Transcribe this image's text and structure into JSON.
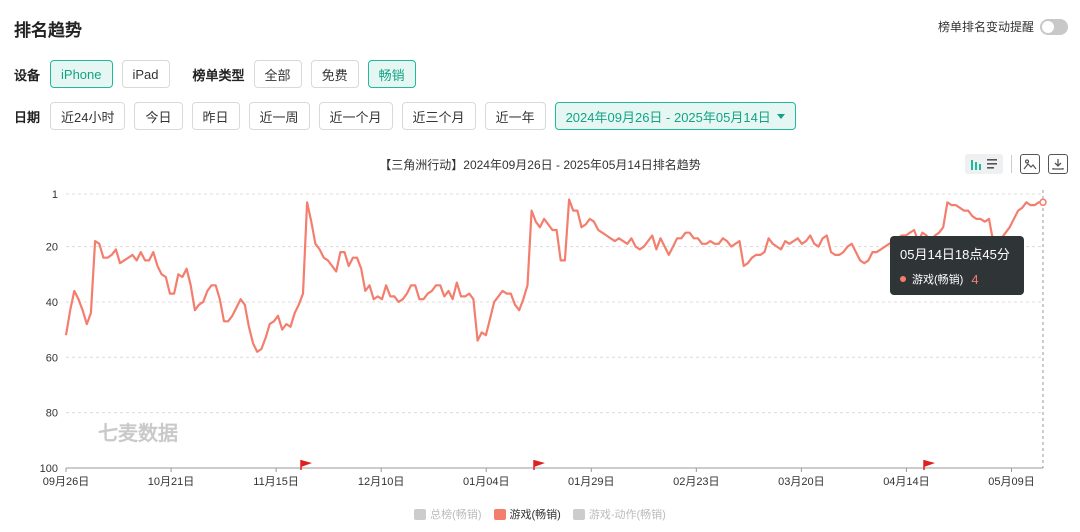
{
  "header": {
    "title": "排名趋势",
    "alert_label": "榜单排名变动提醒"
  },
  "filters": {
    "device_label": "设备",
    "devices": [
      "iPhone",
      "iPad"
    ],
    "list_type_label": "榜单类型",
    "list_types": [
      "全部",
      "免费",
      "畅销"
    ],
    "date_label": "日期",
    "dates": [
      "近24小时",
      "今日",
      "昨日",
      "近一周",
      "近一个月",
      "近三个月",
      "近一年"
    ],
    "date_range": "2024年09月26日 - 2025年05月14日"
  },
  "colors": {
    "accent": "#1fb99e",
    "series": "#f47e6e"
  },
  "icons": {
    "bar": "bar-chart-icon",
    "list": "list-icon",
    "image": "image-icon",
    "download": "download-icon",
    "flag": "flag-icon"
  },
  "watermark": "七麦数据",
  "tooltip": {
    "time": "05月14日18点45分",
    "series": "游戏(畅销)",
    "value": "4"
  },
  "legend": [
    {
      "name": "总榜(畅销)",
      "active": false
    },
    {
      "name": "游戏(畅销)",
      "active": true
    },
    {
      "name": "游戏-动作(畅销)",
      "active": false
    }
  ],
  "chart_data": {
    "type": "line",
    "title": "【三角洲行动】2024年09月26日 - 2025年05月14日排名趋势",
    "y_inverted": true,
    "ylim": [
      1,
      100
    ],
    "y_ticks": [
      "1",
      "20",
      "40",
      "60",
      "80",
      "100"
    ],
    "x_ticks": [
      "09月26日",
      "10月21日",
      "11月15日",
      "12月10日",
      "01月04日",
      "01月29日",
      "02月23日",
      "03月20日",
      "04月14日",
      "05月09日"
    ],
    "flags": [
      "11月16日",
      "01月09日",
      "04月15日"
    ],
    "grid": true,
    "series": [
      {
        "name": "游戏(畅销)",
        "values": [
          52,
          43,
          36,
          39,
          43,
          48,
          44,
          18,
          19,
          24,
          24,
          23,
          21,
          26,
          25,
          24,
          23,
          25,
          22,
          25,
          25,
          22,
          27,
          30,
          31,
          37,
          37,
          30,
          31,
          28,
          34,
          43,
          41,
          40,
          36,
          34,
          34,
          39,
          47,
          47,
          45,
          42,
          39,
          41,
          49,
          55,
          58,
          57,
          53,
          48,
          47,
          45,
          50,
          48,
          49,
          44,
          41,
          37,
          4,
          11,
          19,
          21,
          24,
          25,
          27,
          29,
          22,
          22,
          27,
          24,
          24,
          28,
          36,
          34,
          39,
          38,
          39,
          34,
          38,
          38,
          40,
          39,
          37,
          34,
          34,
          39,
          39,
          37,
          36,
          34,
          34,
          38,
          36,
          39,
          33,
          38,
          38,
          37,
          39,
          54,
          51,
          52,
          46,
          40,
          38,
          36,
          37,
          37,
          41,
          43,
          39,
          34,
          7,
          11,
          13,
          10,
          12,
          14,
          14,
          25,
          25,
          3,
          7,
          7,
          13,
          12,
          10,
          11,
          14,
          15,
          16,
          17,
          18,
          17,
          18,
          19,
          17,
          20,
          21,
          20,
          18,
          16,
          21,
          17,
          20,
          23,
          20,
          17,
          17,
          15,
          15,
          17,
          17,
          19,
          19,
          18,
          19,
          19,
          17,
          18,
          20,
          19,
          18,
          27,
          26,
          24,
          23,
          23,
          22,
          17,
          19,
          20,
          21,
          18,
          19,
          18,
          17,
          19,
          18,
          16,
          19,
          20,
          17,
          16,
          22,
          23,
          23,
          22,
          20,
          19,
          22,
          25,
          26,
          25,
          22,
          22,
          21,
          20,
          19,
          18,
          17,
          16,
          16,
          15,
          14,
          18,
          15,
          16,
          19,
          16,
          15,
          13,
          4,
          5,
          5,
          6,
          7,
          7,
          9,
          10,
          10,
          11,
          10,
          18,
          19,
          17,
          15,
          13,
          10,
          7,
          6,
          4,
          5,
          5,
          4,
          4
        ]
      }
    ]
  }
}
